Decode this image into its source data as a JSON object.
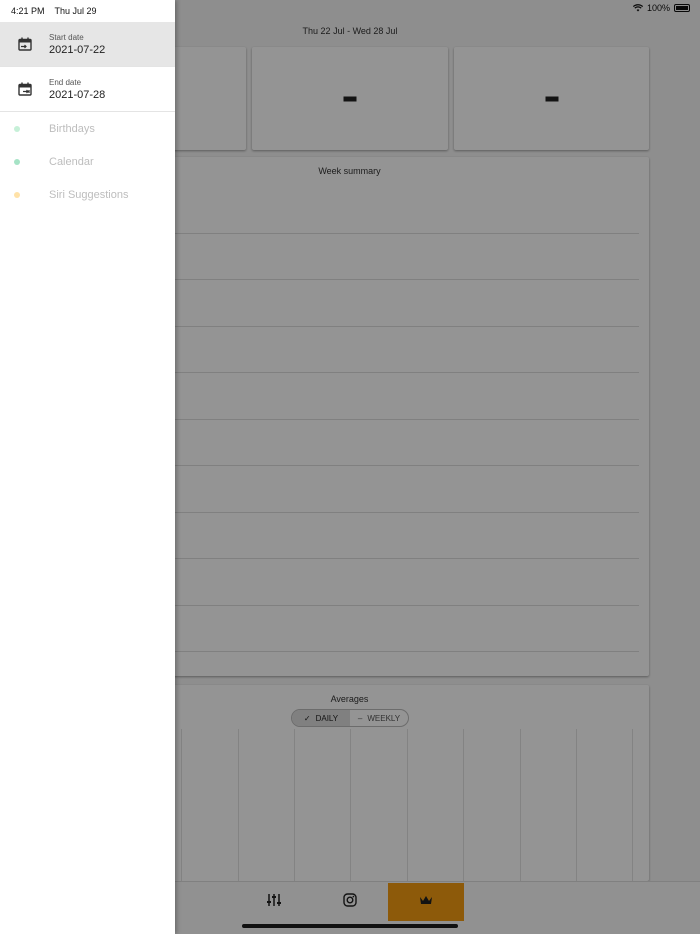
{
  "status_bar": {
    "time": "4:21 PM",
    "date": "Thu Jul 29",
    "battery": "100%"
  },
  "drawer": {
    "start_date": {
      "label": "Start date",
      "value": "2021-07-22",
      "icon": "calendar-start-icon"
    },
    "end_date": {
      "label": "End date",
      "value": "2021-07-28",
      "icon": "calendar-end-icon"
    },
    "calendars": [
      {
        "name": "Birthdays",
        "color": "#c6f0d8"
      },
      {
        "name": "Calendar",
        "color": "#a6e3c6"
      },
      {
        "name": "Siri Suggestions",
        "color": "#ffe2a8"
      }
    ]
  },
  "main": {
    "range_title": "Thu 22 Jul - Wed 28 Jul",
    "stat_cards": [
      {
        "value": "-"
      },
      {
        "value": "-"
      },
      {
        "value": "-"
      }
    ],
    "week_summary_title": "Week summary",
    "averages_title": "Averages",
    "toggle": {
      "daily": "DAILY",
      "weekly": "WEEKLY",
      "selected": "daily"
    }
  },
  "bottom_nav": {
    "items": [
      {
        "icon": "sliders-icon"
      },
      {
        "icon": "instagram-icon"
      },
      {
        "icon": "crown-icon",
        "active": true
      }
    ],
    "accent": "#f39c12"
  }
}
